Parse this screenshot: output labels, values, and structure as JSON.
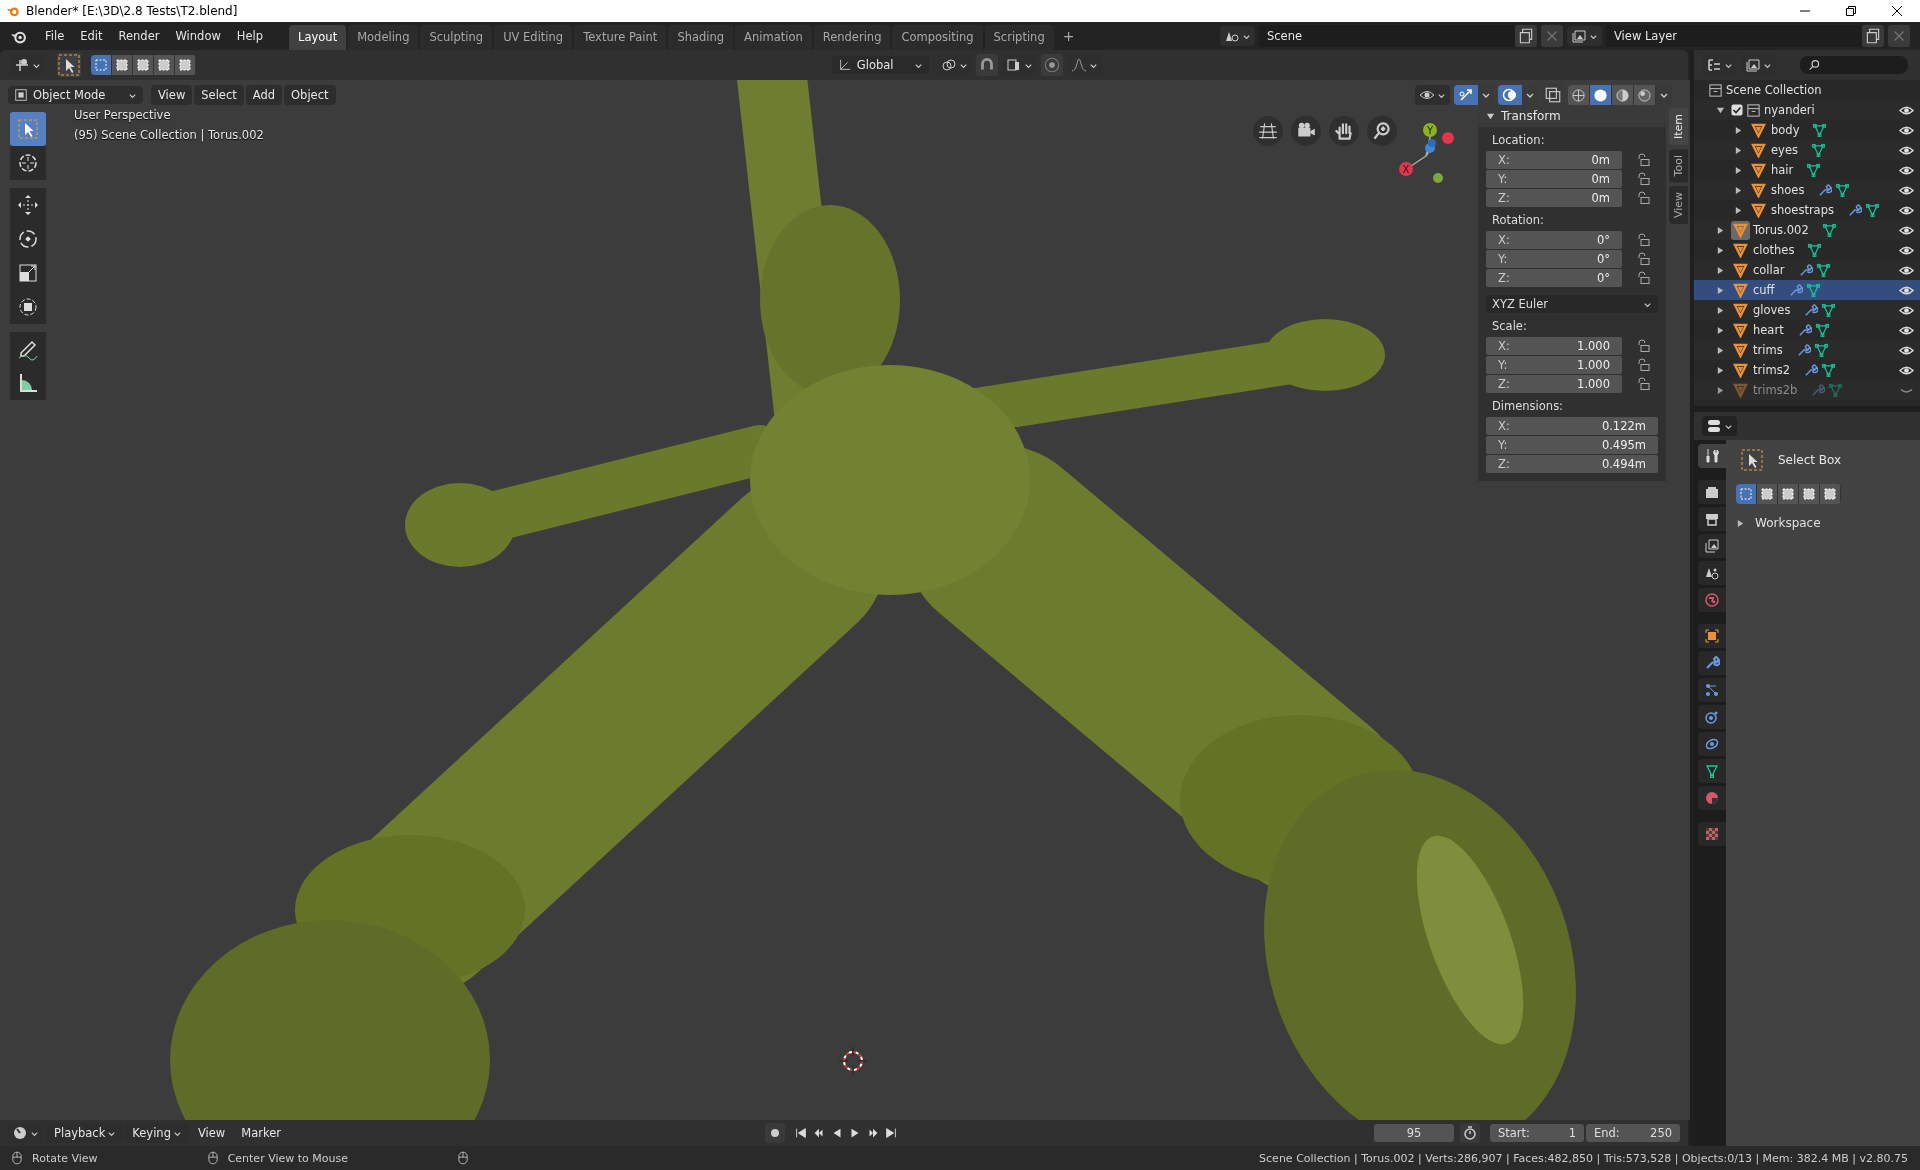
{
  "window": {
    "title": "Blender* [E:\\3D\\2.8 Tests\\T2.blend]"
  },
  "menu": [
    "File",
    "Edit",
    "Render",
    "Window",
    "Help"
  ],
  "workspace_tabs": [
    {
      "label": "Layout",
      "selected": true
    },
    {
      "label": "Modeling",
      "selected": false
    },
    {
      "label": "Sculpting",
      "selected": false
    },
    {
      "label": "UV Editing",
      "selected": false
    },
    {
      "label": "Texture Paint",
      "selected": false
    },
    {
      "label": "Shading",
      "selected": false
    },
    {
      "label": "Animation",
      "selected": false
    },
    {
      "label": "Rendering",
      "selected": false
    },
    {
      "label": "Compositing",
      "selected": false
    },
    {
      "label": "Scripting",
      "selected": false
    }
  ],
  "add_tab": "+",
  "scene": {
    "name": "Scene"
  },
  "view_layer": {
    "name": "View Layer"
  },
  "tool_header": {
    "select_modes": [
      {
        "selected": true
      },
      {
        "selected": false
      },
      {
        "selected": false
      },
      {
        "selected": false
      },
      {
        "selected": false
      }
    ],
    "orientation": "Global"
  },
  "viewport_header": {
    "mode": "Object Mode",
    "menus": [
      "View",
      "Select",
      "Add",
      "Object"
    ],
    "shading": [
      {
        "kind": "wireframe",
        "selected": false
      },
      {
        "kind": "solid",
        "selected": true
      },
      {
        "kind": "material",
        "selected": false
      },
      {
        "kind": "rendered",
        "selected": false
      }
    ]
  },
  "viewport": {
    "perspective": "User Perspective",
    "info": "(95) Scene Collection | Torus.002",
    "gizmo_axes": [
      {
        "label": "X",
        "color": "#e4354a"
      },
      {
        "label": "Y",
        "color": "#8ab31c"
      }
    ]
  },
  "tools": [
    {
      "kind": "select_box",
      "selected": true
    },
    {
      "kind": "cursor",
      "selected": false
    },
    {
      "kind": "move",
      "selected": false
    },
    {
      "kind": "rotate",
      "selected": false
    },
    {
      "kind": "scale",
      "selected": false
    },
    {
      "kind": "transform",
      "selected": false
    },
    {
      "kind": "annotate",
      "selected": false
    },
    {
      "kind": "measure",
      "selected": false
    }
  ],
  "transform_panel": {
    "title": "Transform",
    "sections": [
      {
        "label": "Location:",
        "lockable": true,
        "fields": [
          {
            "axis": "X:",
            "value": "0m"
          },
          {
            "axis": "Y:",
            "value": "0m"
          },
          {
            "axis": "Z:",
            "value": "0m"
          }
        ]
      },
      {
        "label": "Rotation:",
        "lockable": true,
        "fields": [
          {
            "axis": "X:",
            "value": "0°"
          },
          {
            "axis": "Y:",
            "value": "0°"
          },
          {
            "axis": "Z:",
            "value": "0°"
          }
        ],
        "mode": "XYZ Euler"
      },
      {
        "label": "Scale:",
        "lockable": true,
        "fields": [
          {
            "axis": "X:",
            "value": "1.000"
          },
          {
            "axis": "Y:",
            "value": "1.000"
          },
          {
            "axis": "Z:",
            "value": "1.000"
          }
        ]
      },
      {
        "label": "Dimensions:",
        "lockable": false,
        "fields": [
          {
            "axis": "X:",
            "value": "0.122m"
          },
          {
            "axis": "Y:",
            "value": "0.495m"
          },
          {
            "axis": "Z:",
            "value": "0.494m"
          }
        ]
      }
    ]
  },
  "side_tabs": [
    {
      "label": "Item",
      "selected": true
    },
    {
      "label": "Tool",
      "selected": false
    },
    {
      "label": "View",
      "selected": false
    }
  ],
  "outliner": {
    "root": "Scene Collection",
    "items": [
      {
        "name": "nyanderi",
        "kind": "collection",
        "checked": true,
        "expanded": true,
        "visible": true,
        "selected": false,
        "children": [
          {
            "name": "body",
            "kind": "mesh",
            "expanded": false,
            "modifiers": false,
            "visible": true,
            "selected": false,
            "active": false
          },
          {
            "name": "eyes",
            "kind": "mesh",
            "expanded": false,
            "modifiers": false,
            "visible": true,
            "selected": false,
            "active": false
          },
          {
            "name": "hair",
            "kind": "mesh",
            "expanded": false,
            "modifiers": false,
            "visible": true,
            "selected": false,
            "active": false
          },
          {
            "name": "shoes",
            "kind": "mesh",
            "expanded": false,
            "modifiers": true,
            "visible": true,
            "selected": false,
            "active": false
          },
          {
            "name": "shoestraps",
            "kind": "mesh",
            "expanded": false,
            "modifiers": true,
            "visible": true,
            "selected": false,
            "active": false
          }
        ]
      },
      {
        "name": "Torus.002",
        "kind": "mesh",
        "expanded": false,
        "modifiers": false,
        "visible": true,
        "selected": false,
        "active": true
      },
      {
        "name": "clothes",
        "kind": "mesh",
        "expanded": false,
        "modifiers": false,
        "visible": true,
        "selected": false,
        "active": false
      },
      {
        "name": "collar",
        "kind": "mesh",
        "expanded": false,
        "modifiers": true,
        "visible": true,
        "selected": false,
        "active": false
      },
      {
        "name": "cuff",
        "kind": "mesh",
        "expanded": false,
        "modifiers": true,
        "visible": true,
        "selected": true,
        "active": false
      },
      {
        "name": "gloves",
        "kind": "mesh",
        "expanded": false,
        "modifiers": true,
        "visible": true,
        "selected": false,
        "active": false
      },
      {
        "name": "heart",
        "kind": "mesh",
        "expanded": false,
        "modifiers": true,
        "visible": true,
        "selected": false,
        "active": false
      },
      {
        "name": "trims",
        "kind": "mesh",
        "expanded": false,
        "modifiers": true,
        "visible": true,
        "selected": false,
        "active": false
      },
      {
        "name": "trims2",
        "kind": "mesh",
        "expanded": false,
        "modifiers": true,
        "visible": true,
        "selected": false,
        "active": false
      },
      {
        "name": "trims2b",
        "kind": "mesh",
        "expanded": false,
        "modifiers": true,
        "visible": false,
        "selected": false,
        "active": false
      }
    ]
  },
  "properties": {
    "tabs": [
      {
        "kind": "tool",
        "selected": true
      },
      {
        "kind": "render",
        "selected": false
      },
      {
        "kind": "output",
        "selected": false
      },
      {
        "kind": "view_layer",
        "selected": false
      },
      {
        "kind": "scene",
        "selected": false
      },
      {
        "kind": "world",
        "selected": false
      },
      {
        "kind": "object",
        "selected": false
      },
      {
        "kind": "modifiers",
        "selected": false
      },
      {
        "kind": "particles",
        "selected": false
      },
      {
        "kind": "physics",
        "selected": false
      },
      {
        "kind": "constraints",
        "selected": false
      },
      {
        "kind": "data",
        "selected": false
      },
      {
        "kind": "material",
        "selected": false
      },
      {
        "kind": "texture",
        "selected": false
      }
    ],
    "tool": "Select Box",
    "select_modes": [
      {
        "selected": true
      },
      {
        "selected": false
      },
      {
        "selected": false
      },
      {
        "selected": false
      },
      {
        "selected": false
      }
    ],
    "section": "Workspace"
  },
  "timeline": {
    "menus": [
      {
        "label": "Playback",
        "dropdown": true
      },
      {
        "label": "Keying",
        "dropdown": true
      },
      {
        "label": "View",
        "dropdown": false
      },
      {
        "label": "Marker",
        "dropdown": false
      }
    ],
    "current_frame": "95",
    "start_label": "Start:",
    "start": "1",
    "end_label": "End:",
    "end": "250"
  },
  "status_bar": {
    "hints": [
      "Rotate View",
      "Center View to Mouse"
    ],
    "stats": "Scene Collection | Torus.002 | Verts:286,907 | Faces:482,850 | Tris:573,528 | Objects:0/13 | Mem: 382.4 MB | v2.80.75"
  }
}
